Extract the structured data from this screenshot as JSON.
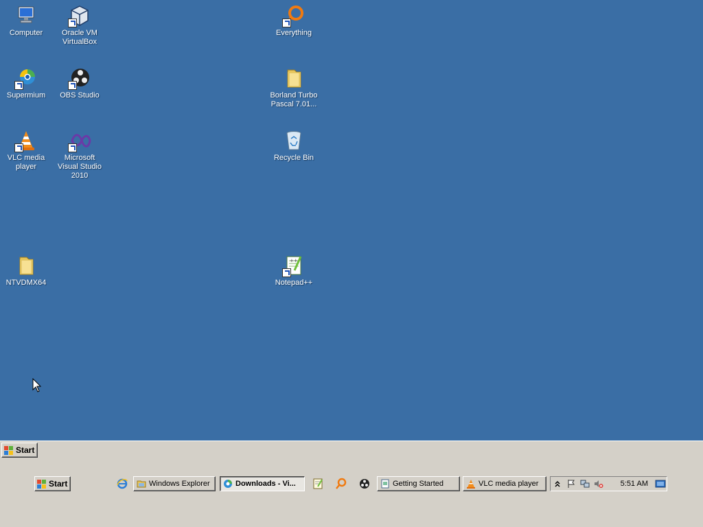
{
  "desktop": {
    "icons": [
      {
        "label": "Computer",
        "icon": "computer-icon"
      },
      {
        "label": "Oracle VM VirtualBox",
        "icon": "virtualbox-icon"
      },
      {
        "label": "Everything",
        "icon": "everything-search-icon"
      },
      {
        "label": "Supermium",
        "icon": "supermium-browser-icon"
      },
      {
        "label": "OBS Studio",
        "icon": "obs-studio-icon"
      },
      {
        "label": "Borland Turbo Pascal 7.01...",
        "icon": "folder-icon"
      },
      {
        "label": "VLC media player",
        "icon": "vlc-cone-icon"
      },
      {
        "label": "Microsoft Visual Studio 2010",
        "icon": "visual-studio-icon"
      },
      {
        "label": "Recycle Bin",
        "icon": "recycle-bin-icon"
      },
      {
        "label": "NTVDMX64",
        "icon": "folder-icon"
      },
      {
        "label": "Notepad++",
        "icon": "notepadplusplus-icon"
      }
    ]
  },
  "taskbar_top": {
    "start_label": "Start"
  },
  "taskbar_bottom": {
    "start_label": "Start",
    "quick_launch": [
      {
        "icon": "internet-explorer-icon"
      }
    ],
    "buttons": [
      {
        "label": "Windows Explorer",
        "icon": "explorer-folder-icon",
        "active": false
      },
      {
        "label": "Downloads - Vi...",
        "icon": "browser-icon",
        "active": true
      },
      {
        "label": "",
        "icon": "notepad-icon",
        "active": false
      },
      {
        "label": "",
        "icon": "search-magnifier-icon",
        "active": false
      },
      {
        "label": "",
        "icon": "obs-icon",
        "active": false
      },
      {
        "label": "Getting Started",
        "icon": "document-icon",
        "active": false
      },
      {
        "label": "VLC media player",
        "icon": "vlc-icon",
        "active": false
      }
    ],
    "tray": {
      "icons": [
        "expand-chevron-icon",
        "action-center-flag-icon",
        "network-icon",
        "volume-muted-icon"
      ],
      "clock": "5:51 AM",
      "show_desktop_icon": "show-desktop-icon"
    }
  },
  "colors": {
    "desktop_bg": "#3a6ea5",
    "taskbar_bg": "#d4d0c8"
  }
}
